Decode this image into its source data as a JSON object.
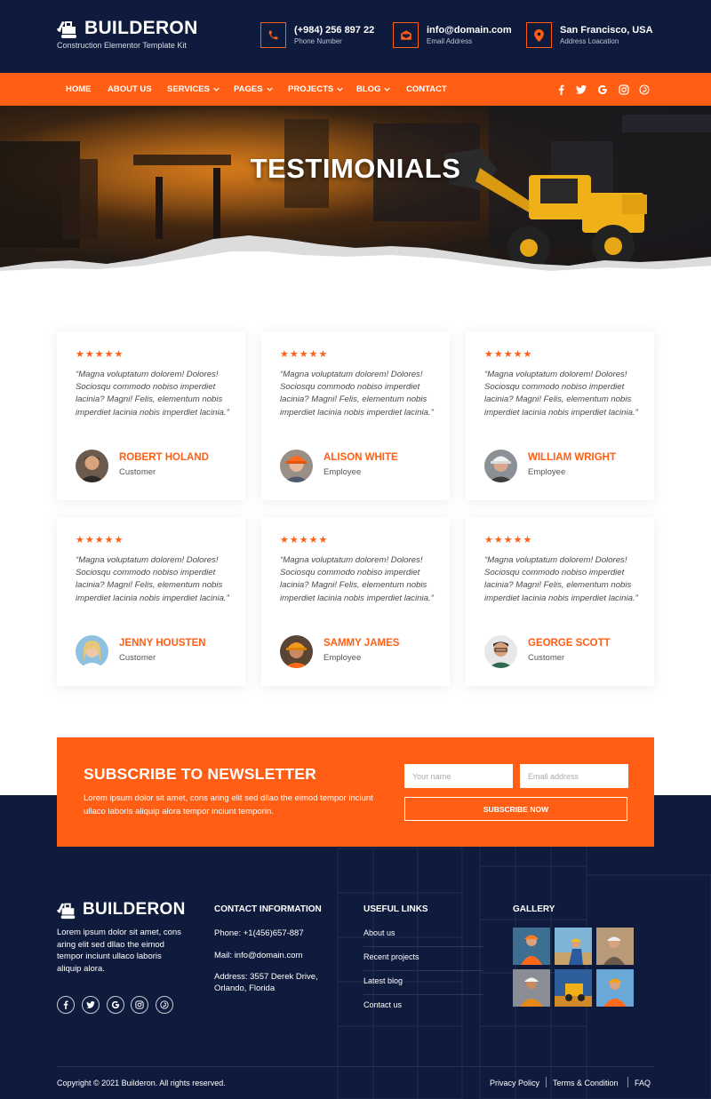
{
  "brand": {
    "name": "BUILDERON",
    "tagline": "Construction Elementor Template Kit"
  },
  "contacts": [
    {
      "value": "(+984) 256 897 22",
      "label": "Phone Number",
      "icon": "phone-icon"
    },
    {
      "value": "info@domain.com",
      "label": "Email Address",
      "icon": "email-icon"
    },
    {
      "value": "San Francisco, USA",
      "label": "Address Loacation",
      "icon": "location-icon"
    }
  ],
  "nav": {
    "items": [
      "HOME",
      "ABOUT US",
      "SERVICES",
      "PAGES",
      "PROJECTS",
      "BLOG",
      "CONTACT"
    ],
    "social": [
      "facebook-icon",
      "twitter-icon",
      "google-icon",
      "instagram-icon",
      "pinterest-icon"
    ]
  },
  "hero": {
    "title": "TESTIMONIALS"
  },
  "testimonials": [
    {
      "rating": 5,
      "stars": "★★★★★",
      "quote": "“Magna voluptatum dolorem! Dolores! Sociosqu commodo nobiso imperdiet lacinia? Magni! Felis, elementum nobis imperdiet lacinia nobis imperdiet lacinia.”",
      "name": "ROBERT HOLAND",
      "role": "Customer"
    },
    {
      "rating": 5,
      "stars": "★★★★★",
      "quote": "“Magna voluptatum dolorem! Dolores! Sociosqu commodo nobiso imperdiet lacinia? Magni! Felis, elementum nobis imperdiet lacinia nobis imperdiet lacinia.”",
      "name": "ALISON WHITE",
      "role": "Employee"
    },
    {
      "rating": 5,
      "stars": "★★★★★",
      "quote": "“Magna voluptatum dolorem! Dolores! Sociosqu commodo nobiso imperdiet lacinia? Magni! Felis, elementum nobis imperdiet lacinia nobis imperdiet lacinia.”",
      "name": "WILLIAM WRIGHT",
      "role": "Employee"
    },
    {
      "rating": 5,
      "stars": "★★★★★",
      "quote": "“Magna voluptatum dolorem! Dolores! Sociosqu commodo nobiso imperdiet lacinia? Magni! Felis, elementum nobis imperdiet lacinia nobis imperdiet lacinia.”",
      "name": "JENNY HOUSTEN",
      "role": "Customer"
    },
    {
      "rating": 5,
      "stars": "★★★★★",
      "quote": "“Magna voluptatum dolorem! Dolores! Sociosqu commodo nobiso imperdiet lacinia? Magni! Felis, elementum nobis imperdiet lacinia nobis imperdiet lacinia.”",
      "name": "SAMMY JAMES",
      "role": "Employee"
    },
    {
      "rating": 5,
      "stars": "★★★★★",
      "quote": "“Magna voluptatum dolorem! Dolores! Sociosqu commodo nobiso imperdiet lacinia? Magni! Felis, elementum nobis imperdiet lacinia nobis imperdiet lacinia.”",
      "name": "GEORGE SCOTT",
      "role": "Customer"
    }
  ],
  "newsletter": {
    "title": "SUBSCRIBE TO NEWSLETTER",
    "description": "Lorem ipsum dolor sit amet, cons aring elit sed dllao the eimod tempor inciunt ullaco laboris aliquip alora tempor inciunt temporin.",
    "name_placeholder": "Your name",
    "email_placeholder": "Email address",
    "button": "SUBSCRIBE NOW"
  },
  "footer": {
    "brand": "BUILDERON",
    "about": "Lorem ipsum dolor sit amet, cons aring elit sed dllao the eimod tempor inciunt ullaco laboris aliquip alora.",
    "social": [
      "facebook-icon",
      "twitter-icon",
      "google-icon",
      "instagram-icon",
      "pinterest-icon"
    ],
    "contact_heading": "CONTACT INFORMATION",
    "phone": "Phone: +1(456)657-887",
    "mail": "Mail: info@domain.com",
    "address": "Address: 3557 Derek Drive, Orlando, Florida",
    "links_heading": "USEFUL LINKS",
    "links": [
      "About us",
      "Recent projects",
      "Latest blog",
      "Contact us"
    ],
    "gallery_heading": "GALLERY",
    "copyright": "Copyright © 2021 Builderon. All rights reserved.",
    "legal": [
      "Privacy Policy",
      "Terms & Condition",
      "FAQ"
    ]
  },
  "colors": {
    "accent": "#ff5e14",
    "navy": "#0f1b3c",
    "white": "#ffffff"
  }
}
